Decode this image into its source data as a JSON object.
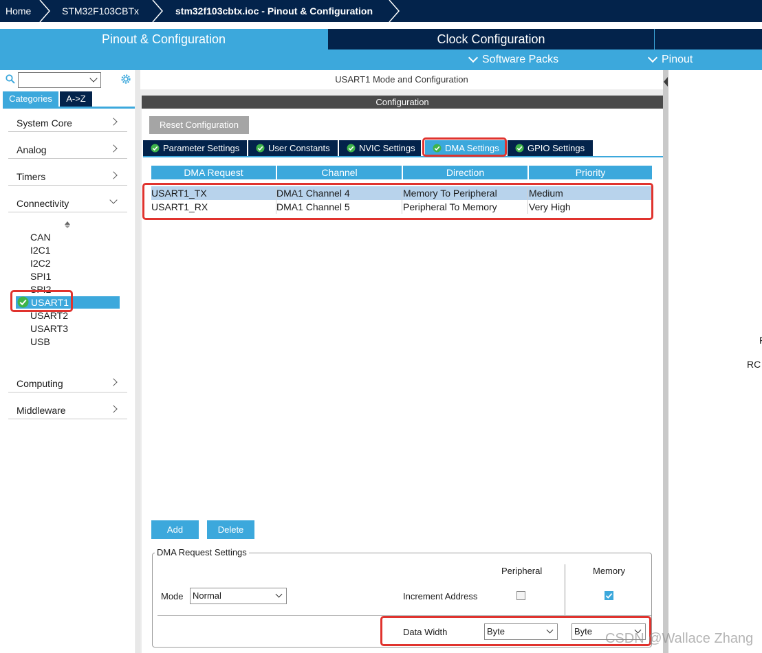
{
  "breadcrumb": {
    "home": "Home",
    "device": "STM32F103CBTx",
    "file": "stm32f103cbtx.ioc - Pinout & Configuration"
  },
  "top_tabs": {
    "pinout": "Pinout & Configuration",
    "clock": "Clock Configuration",
    "software_packs": "Software Packs",
    "pinout_menu": "Pinout"
  },
  "sidebar": {
    "search_value": "",
    "tabs": [
      "Categories",
      "A->Z"
    ],
    "categories": [
      {
        "label": "System Core"
      },
      {
        "label": "Analog"
      },
      {
        "label": "Timers"
      },
      {
        "label": "Connectivity"
      },
      {
        "label": "Computing"
      },
      {
        "label": "Middleware"
      }
    ],
    "connectivity_items": [
      "CAN",
      "I2C1",
      "I2C2",
      "SPI1",
      "SPI2",
      "USART1",
      "USART2",
      "USART3",
      "USB"
    ],
    "selected": "USART1"
  },
  "main": {
    "title": "USART1 Mode and Configuration",
    "config_header": "Configuration",
    "reset_label": "Reset Configuration",
    "tabs": [
      "Parameter Settings",
      "User Constants",
      "NVIC Settings",
      "DMA Settings",
      "GPIO Settings"
    ],
    "active_tab": "DMA Settings",
    "table": {
      "headers": [
        "DMA Request",
        "Channel",
        "Direction",
        "Priority"
      ],
      "rows": [
        [
          "USART1_TX",
          "DMA1 Channel 4",
          "Memory To Peripheral",
          "Medium"
        ],
        [
          "USART1_RX",
          "DMA1 Channel 5",
          "Peripheral To Memory",
          "Very High"
        ]
      ]
    },
    "add_label": "Add",
    "delete_label": "Delete",
    "dma_settings": {
      "legend": "DMA Request Settings",
      "peripheral_label": "Peripheral",
      "memory_label": "Memory",
      "mode_label": "Mode",
      "mode_value": "Normal",
      "increment_label": "Increment Address",
      "increment_peripheral": false,
      "increment_memory": true,
      "data_width_label": "Data Width",
      "data_width_peripheral": "Byte",
      "data_width_memory": "Byte"
    }
  },
  "right_panel": {
    "text1": "F",
    "text2": "RC"
  },
  "watermark": "CSDN @Wallace Zhang",
  "colors": {
    "navy": "#03234b",
    "accent": "#3ca8dc",
    "highlight": "#e0332e",
    "ok_green": "#3fb44a"
  }
}
